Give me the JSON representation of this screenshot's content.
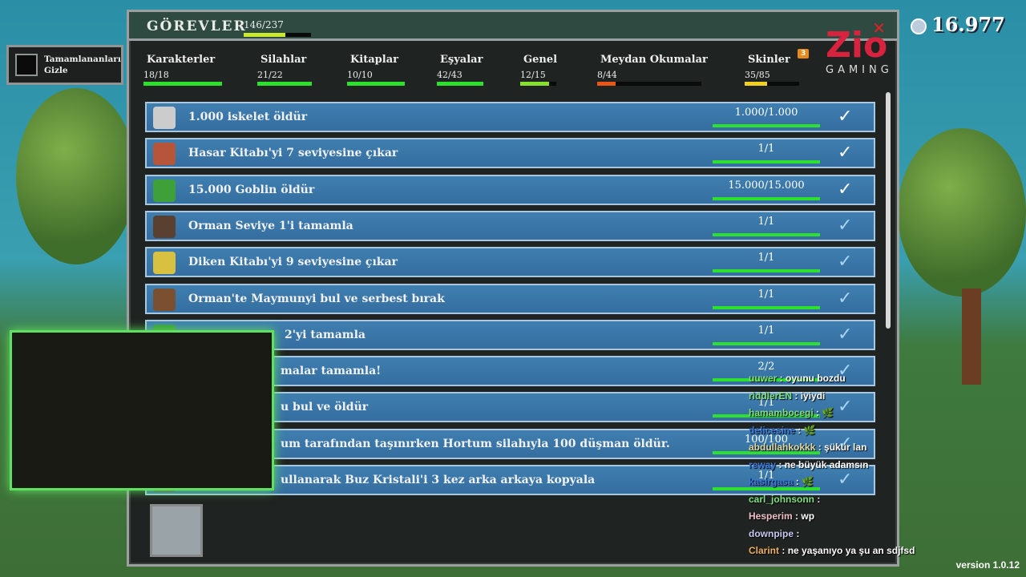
{
  "header": {
    "title": "GÖREVLER",
    "total": "146/237",
    "total_fraction": 0.616
  },
  "hide_completed": {
    "label_line1": "Tamamlananları",
    "label_line2": "Gizle"
  },
  "coins": "16.977",
  "logo": {
    "brand": "Zio",
    "sub": "GAMING"
  },
  "tabs": [
    {
      "label": "Karakterler",
      "count": "18/18",
      "fill": 1.0,
      "color": "#2ee02e"
    },
    {
      "label": "Silahlar",
      "count": "21/22",
      "fill": 1.0,
      "color": "#2ee02e"
    },
    {
      "label": "Kitaplar",
      "count": "10/10",
      "fill": 1.0,
      "color": "#2ee02e"
    },
    {
      "label": "Eşyalar",
      "count": "42/43",
      "fill": 1.0,
      "color": "#2ee02e"
    },
    {
      "label": "Genel",
      "count": "12/15",
      "fill": 0.8,
      "color": "#88e02e"
    },
    {
      "label": "Meydan Okumalar",
      "count": "8/44",
      "fill": 0.18,
      "color": "#e8561a"
    },
    {
      "label": "Skinler",
      "count": "35/85",
      "fill": 0.41,
      "color": "#f0d020",
      "badge": "3"
    }
  ],
  "quests": [
    {
      "text": "1.000 iskelet öldür",
      "count": "1.000/1.000",
      "check": "#ffffff",
      "ava": "#ccc"
    },
    {
      "text": "Hasar Kitabı'yi 7 seviyesine çıkar",
      "count": "1/1",
      "check": "#ffffff",
      "ava": "#b5563a"
    },
    {
      "text": "15.000 Goblin öldür",
      "count": "15.000/15.000",
      "check": "#ffffff",
      "ava": "#3fa03a"
    },
    {
      "text": "Orman Seviye 1'i tamamla",
      "count": "1/1",
      "check": "#a9d4f5",
      "ava": "#5a4030"
    },
    {
      "text": "Diken Kitabı'yi 9 seviyesine çıkar",
      "count": "1/1",
      "check": "#a9d4f5",
      "ava": "#d8c040"
    },
    {
      "text": "Orman'te Maymunyi bul ve serbest bırak",
      "count": "1/1",
      "check": "#a9d4f5",
      "ava": "#7a5030"
    },
    {
      "text": "2'yi tamamla",
      "count": "1/1",
      "check": "#a9d4f5",
      "ava": "#3a9a3a"
    },
    {
      "text": "malar tamamla!",
      "count": "2/2",
      "check": "#a9d4f5",
      "ava": "#555"
    },
    {
      "text": "u bul ve öldür",
      "count": "1/1",
      "check": "#a9d4f5",
      "ava": "#555"
    },
    {
      "text": "um tarafından taşınırken Hortum silahıyla 100 düşman öldür.",
      "count": "100/100",
      "check": "#a9d4f5",
      "ava": "#555"
    },
    {
      "text": "ullanarak Buz Kristali'i 3 kez arka arkaya kopyala",
      "count": "1/1",
      "check": "#a9d4f5",
      "ava": "#555"
    }
  ],
  "chat": [
    {
      "user": "uuwer",
      "msg": "oyunu bozdu",
      "color": "#7fe07f"
    },
    {
      "user": "riddlerEN",
      "msg": "iyiydi",
      "color": "#7fe07f"
    },
    {
      "user": "hamambocegi",
      "msg": "🌿",
      "color": "#7fe07f"
    },
    {
      "user": "delicesine",
      "msg": "🌿",
      "color": "#3a7adf"
    },
    {
      "user": "abdullahkokkk",
      "msg": "şükür lan",
      "color": "#e0d8a0"
    },
    {
      "user": "reway",
      "msg": "ne büyük adamsın",
      "color": "#3a7adf"
    },
    {
      "user": "kasirgasa",
      "msg": "🌿",
      "color": "#3a7adf"
    },
    {
      "user": "carl_johnsonn",
      "msg": "",
      "color": "#7fe07f"
    },
    {
      "user": "Hesperim",
      "msg": "wp",
      "color": "#f0c0c8"
    },
    {
      "user": "downpipe",
      "msg": "",
      "color": "#c8c8f0"
    },
    {
      "user": "Clarint",
      "msg": "ne yaşanıyo ya şu an sdjfsd",
      "color": "#f0b060"
    }
  ],
  "version": "version 1.0.12"
}
